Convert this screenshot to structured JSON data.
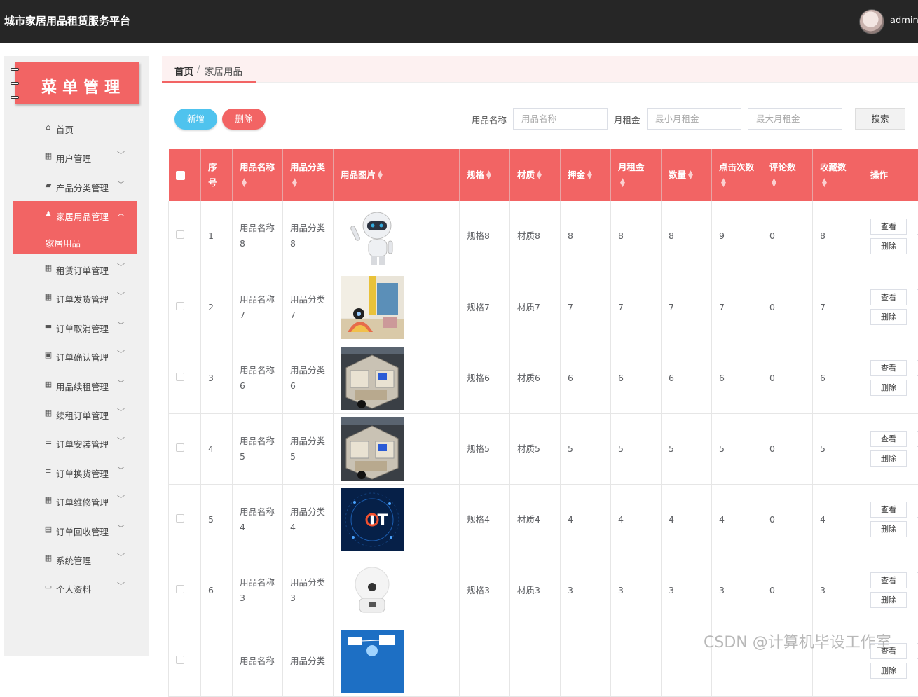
{
  "header": {
    "title": "城市家居用品租赁服务平台",
    "username": "admin"
  },
  "sidebar": {
    "banner": "菜单管理",
    "items": [
      {
        "label": "首页",
        "icon": "home-icon",
        "glyph": "⌂",
        "chev": ""
      },
      {
        "label": "用户管理",
        "icon": "grid-icon",
        "glyph": "▦",
        "chev": "﹀"
      },
      {
        "label": "产品分类管理",
        "icon": "ticket-icon",
        "glyph": "▰",
        "chev": "﹀"
      },
      {
        "label": "家居用品管理",
        "icon": "user-icon",
        "glyph": "♟",
        "chev": "︿"
      },
      {
        "label": "租赁订单管理",
        "icon": "grid-icon",
        "glyph": "▦",
        "chev": "﹀"
      },
      {
        "label": "订单发货管理",
        "icon": "grid-icon",
        "glyph": "▦",
        "chev": "﹀"
      },
      {
        "label": "订单取消管理",
        "icon": "monitor-icon",
        "glyph": "▬",
        "chev": "﹀"
      },
      {
        "label": "订单确认管理",
        "icon": "clipboard-icon",
        "glyph": "▣",
        "chev": "﹀"
      },
      {
        "label": "用品续租管理",
        "icon": "grid-icon",
        "glyph": "▦",
        "chev": "﹀"
      },
      {
        "label": "续租订单管理",
        "icon": "grid-icon",
        "glyph": "▦",
        "chev": "﹀"
      },
      {
        "label": "订单安装管理",
        "icon": "sliders-icon",
        "glyph": "☰",
        "chev": "﹀"
      },
      {
        "label": "订单换货管理",
        "icon": "list-icon",
        "glyph": "≡",
        "chev": "﹀"
      },
      {
        "label": "订单维修管理",
        "icon": "grid-icon",
        "glyph": "▦",
        "chev": "﹀"
      },
      {
        "label": "订单回收管理",
        "icon": "document-icon",
        "glyph": "▤",
        "chev": "﹀"
      },
      {
        "label": "系统管理",
        "icon": "grid-icon",
        "glyph": "▦",
        "chev": "﹀"
      },
      {
        "label": "个人资料",
        "icon": "card-icon",
        "glyph": "▭",
        "chev": "﹀"
      }
    ],
    "active_sub": "家居用品"
  },
  "breadcrumb": {
    "home": "首页",
    "separator": "/",
    "current": "家居用品"
  },
  "toolbar": {
    "add_label": "新增",
    "delete_label": "删除",
    "name_label": "用品名称",
    "name_placeholder": "用品名称",
    "rent_label": "月租金",
    "min_placeholder": "最小月租金",
    "max_placeholder": "最大月租金",
    "search_label": "搜索"
  },
  "table": {
    "headers": [
      "序号",
      "用品名称",
      "用品分类",
      "用品图片",
      "规格",
      "材质",
      "押金",
      "月租金",
      "数量",
      "点击次数",
      "评论数",
      "收藏数",
      "操作"
    ],
    "view_label": "查看",
    "delete_label": "删除",
    "rows": [
      {
        "no": "1",
        "name": "用品名称8",
        "category": "用品分类8",
        "spec": "规格8",
        "material": "材质8",
        "deposit": "8",
        "rent": "8",
        "qty": "8",
        "clicks": "9",
        "comments": "0",
        "favs": "8",
        "image": "robot"
      },
      {
        "no": "2",
        "name": "用品名称7",
        "category": "用品分类7",
        "spec": "规格7",
        "material": "材质7",
        "deposit": "7",
        "rent": "7",
        "qty": "7",
        "clicks": "7",
        "comments": "0",
        "favs": "7",
        "image": "room"
      },
      {
        "no": "3",
        "name": "用品名称6",
        "category": "用品分类6",
        "spec": "规格6",
        "material": "材质6",
        "deposit": "6",
        "rent": "6",
        "qty": "6",
        "clicks": "6",
        "comments": "0",
        "favs": "6",
        "image": "house"
      },
      {
        "no": "4",
        "name": "用品名称5",
        "category": "用品分类5",
        "spec": "规格5",
        "material": "材质5",
        "deposit": "5",
        "rent": "5",
        "qty": "5",
        "clicks": "5",
        "comments": "0",
        "favs": "5",
        "image": "house"
      },
      {
        "no": "5",
        "name": "用品名称4",
        "category": "用品分类4",
        "spec": "规格4",
        "material": "材质4",
        "deposit": "4",
        "rent": "4",
        "qty": "4",
        "clicks": "4",
        "comments": "0",
        "favs": "4",
        "image": "iot"
      },
      {
        "no": "6",
        "name": "用品名称3",
        "category": "用品分类3",
        "spec": "规格3",
        "material": "材质3",
        "deposit": "3",
        "rent": "3",
        "qty": "3",
        "clicks": "3",
        "comments": "0",
        "favs": "3",
        "image": "camera"
      },
      {
        "no": "",
        "name": "用品名称",
        "category": "用品分类",
        "spec": "",
        "material": "",
        "deposit": "",
        "rent": "",
        "qty": "",
        "clicks": "",
        "comments": "",
        "favs": "",
        "image": "network"
      }
    ]
  },
  "watermark": "CSDN @计算机毕设工作室",
  "colors": {
    "accent": "#f26464",
    "topbar": "#262626",
    "add_button": "#4fc3ee"
  }
}
